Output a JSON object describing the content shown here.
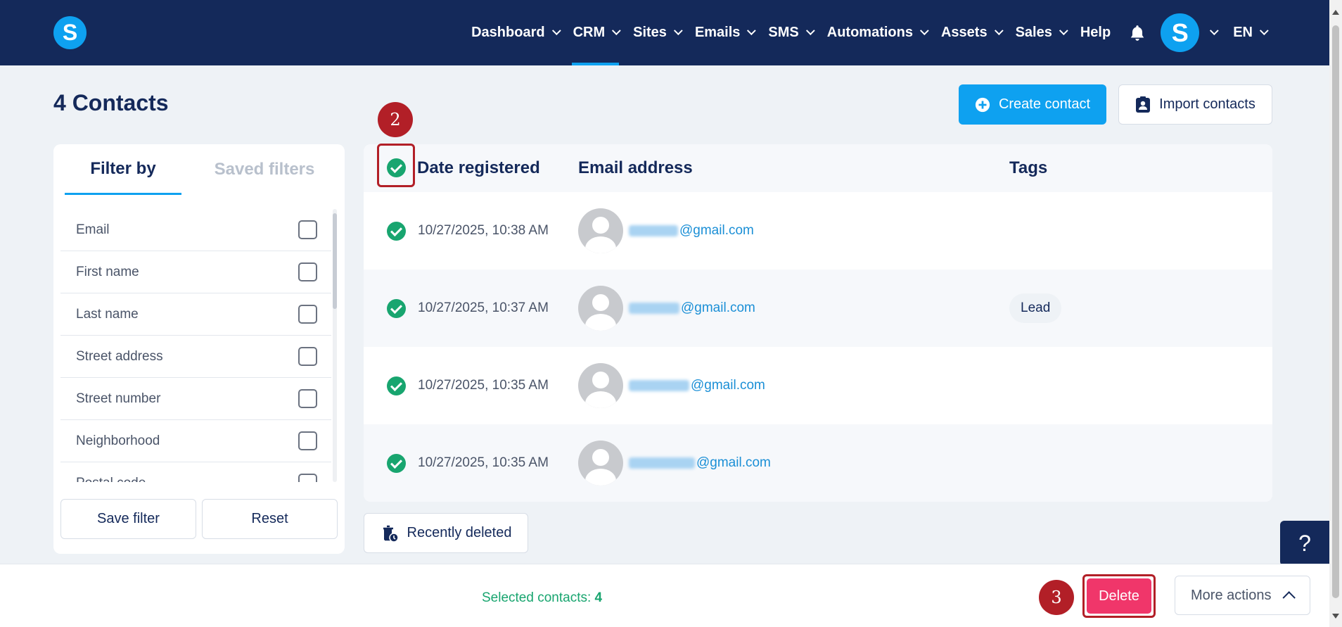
{
  "nav": {
    "logo_letter": "S",
    "items": [
      {
        "label": "Dashboard",
        "dropdown": true
      },
      {
        "label": "CRM",
        "dropdown": true,
        "active": true
      },
      {
        "label": "Sites",
        "dropdown": true
      },
      {
        "label": "Emails",
        "dropdown": true
      },
      {
        "label": "SMS",
        "dropdown": true
      },
      {
        "label": "Automations",
        "dropdown": true
      },
      {
        "label": "Assets",
        "dropdown": true
      },
      {
        "label": "Sales",
        "dropdown": true
      },
      {
        "label": "Help",
        "dropdown": false
      }
    ],
    "avatar_letter": "S",
    "language": "EN"
  },
  "page": {
    "title": "4 Contacts",
    "create_label": "Create contact",
    "import_label": "Import contacts"
  },
  "filters": {
    "tab_active": "Filter by",
    "tab_inactive": "Saved filters",
    "fields": [
      "Email",
      "First name",
      "Last name",
      "Street address",
      "Street number",
      "Neighborhood",
      "Postal code"
    ],
    "save_label": "Save filter",
    "reset_label": "Reset"
  },
  "table": {
    "headers": {
      "date": "Date registered",
      "email": "Email address",
      "tags": "Tags"
    },
    "rows": [
      {
        "date": "10/27/2025, 10:38 AM",
        "email_domain": "@gmail.com",
        "tag": ""
      },
      {
        "date": "10/27/2025, 10:37 AM",
        "email_domain": "@gmail.com",
        "tag": "Lead"
      },
      {
        "date": "10/27/2025, 10:35 AM",
        "email_domain": "@gmail.com",
        "tag": ""
      },
      {
        "date": "10/27/2025, 10:35 AM",
        "email_domain": "@gmail.com",
        "tag": ""
      }
    ]
  },
  "recently_deleted_label": "Recently deleted",
  "annotations": {
    "step_2": "2",
    "step_3": "3"
  },
  "help_label": "?",
  "bottom": {
    "selected_text": "Selected contacts:",
    "selected_count": "4",
    "delete_label": "Delete",
    "more_label": "More actions"
  },
  "colors": {
    "navbar": "#14295a",
    "accent": "#0ea1f0",
    "success": "#18a56f",
    "danger": "#f0366a",
    "annotation": "#b21f27"
  },
  "icons": {
    "bell": "bell-icon",
    "plus": "plus-circle-icon",
    "import": "contact-card-icon",
    "trash": "trash-clock-icon",
    "check": "check-circle-icon"
  }
}
